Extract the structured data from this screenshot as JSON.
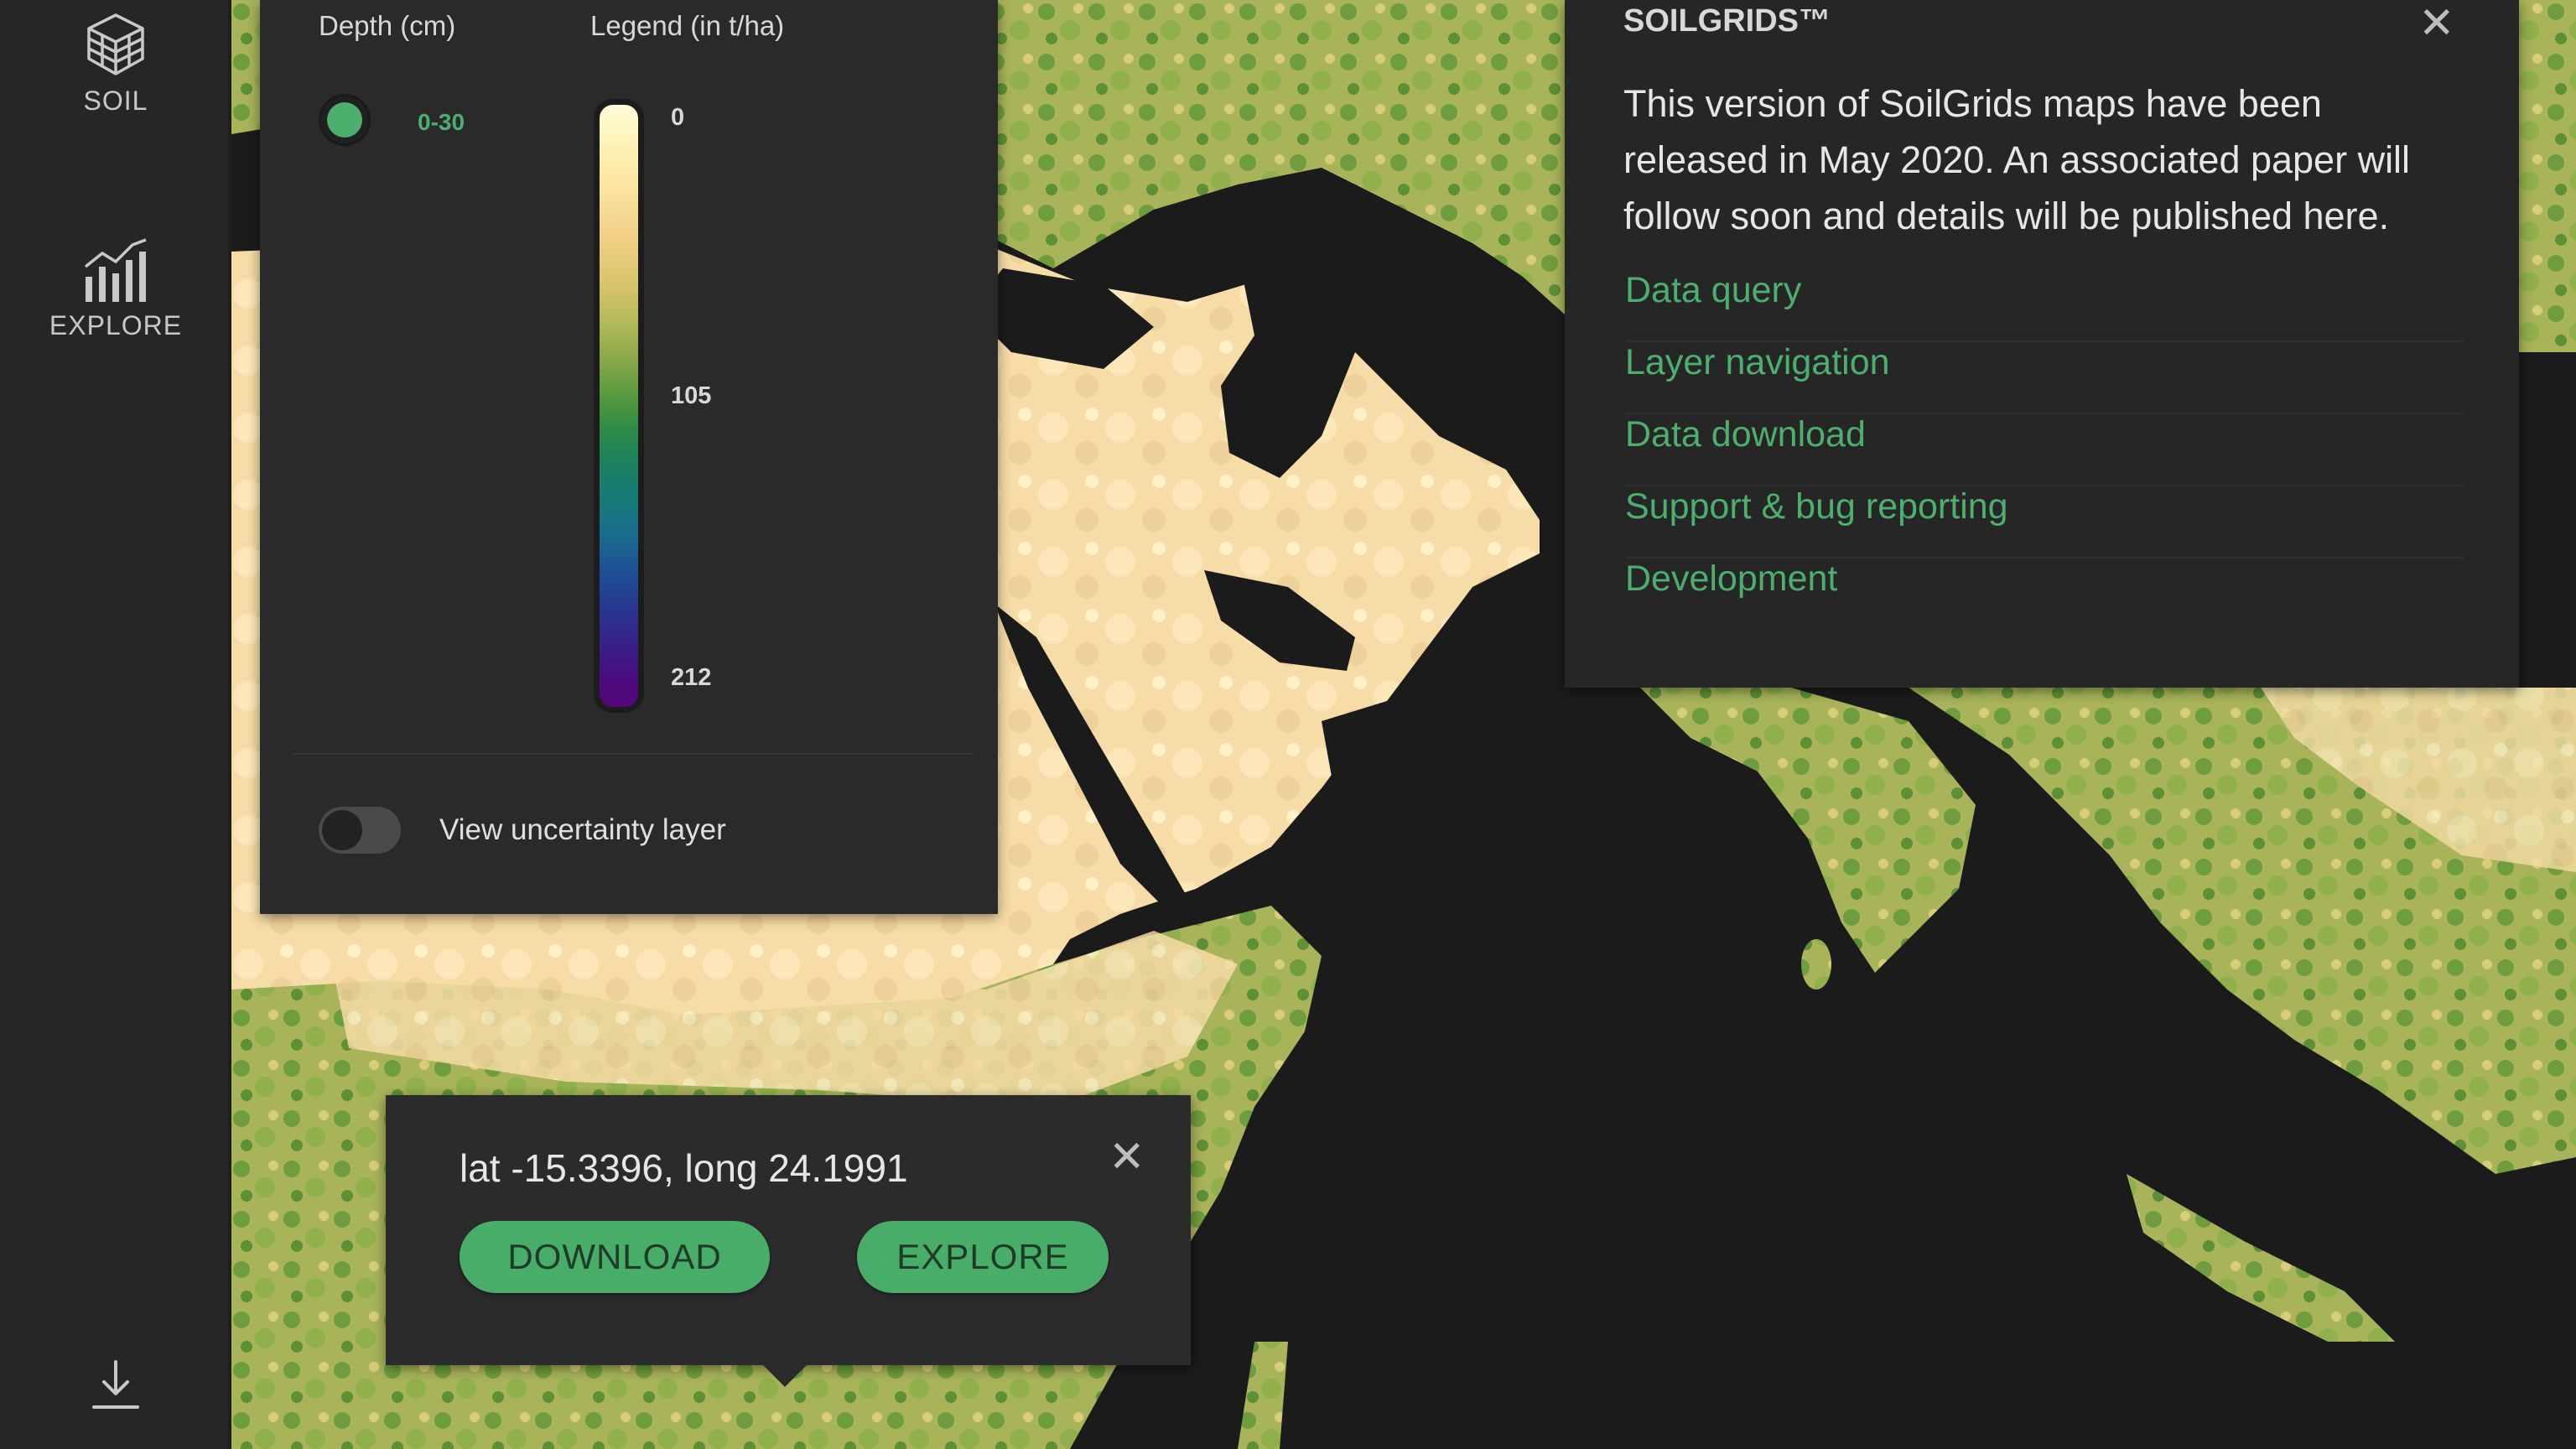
{
  "sidebar": {
    "items": [
      {
        "label": "SOIL",
        "icon": "layers-stack-icon"
      },
      {
        "label": "EXPLORE",
        "icon": "bar-chart-icon"
      }
    ],
    "bottom_icon": "download-icon"
  },
  "legend_panel": {
    "depth_header": "Depth (cm)",
    "legend_header": "Legend (in t/ha)",
    "depth_option": "0-30",
    "scale_ticks": [
      "0",
      "105",
      "212"
    ],
    "scale_values": [
      0,
      105,
      212
    ],
    "uncertainty_label": "View uncertainty layer",
    "uncertainty_enabled": false
  },
  "info_panel": {
    "title": "SOILGRIDS™",
    "close_label": "✕",
    "description": "This version of SoilGrids maps have been released in May 2020. An associated paper will follow soon and details will be published here.",
    "links": [
      "Data query",
      "Layer navigation",
      "Data download",
      "Support & bug reporting",
      "Development"
    ]
  },
  "popup": {
    "coords": "lat -15.3396, long 24.1991",
    "close_label": "✕",
    "download_label": "DOWNLOAD",
    "explore_label": "EXPLORE"
  },
  "colors": {
    "accent": "#4caf6d",
    "panel_bg": "#2a2a2a",
    "map_water": "#1b1b1b",
    "map_sand": "#f6deaa",
    "map_green": "#7aa24a"
  }
}
